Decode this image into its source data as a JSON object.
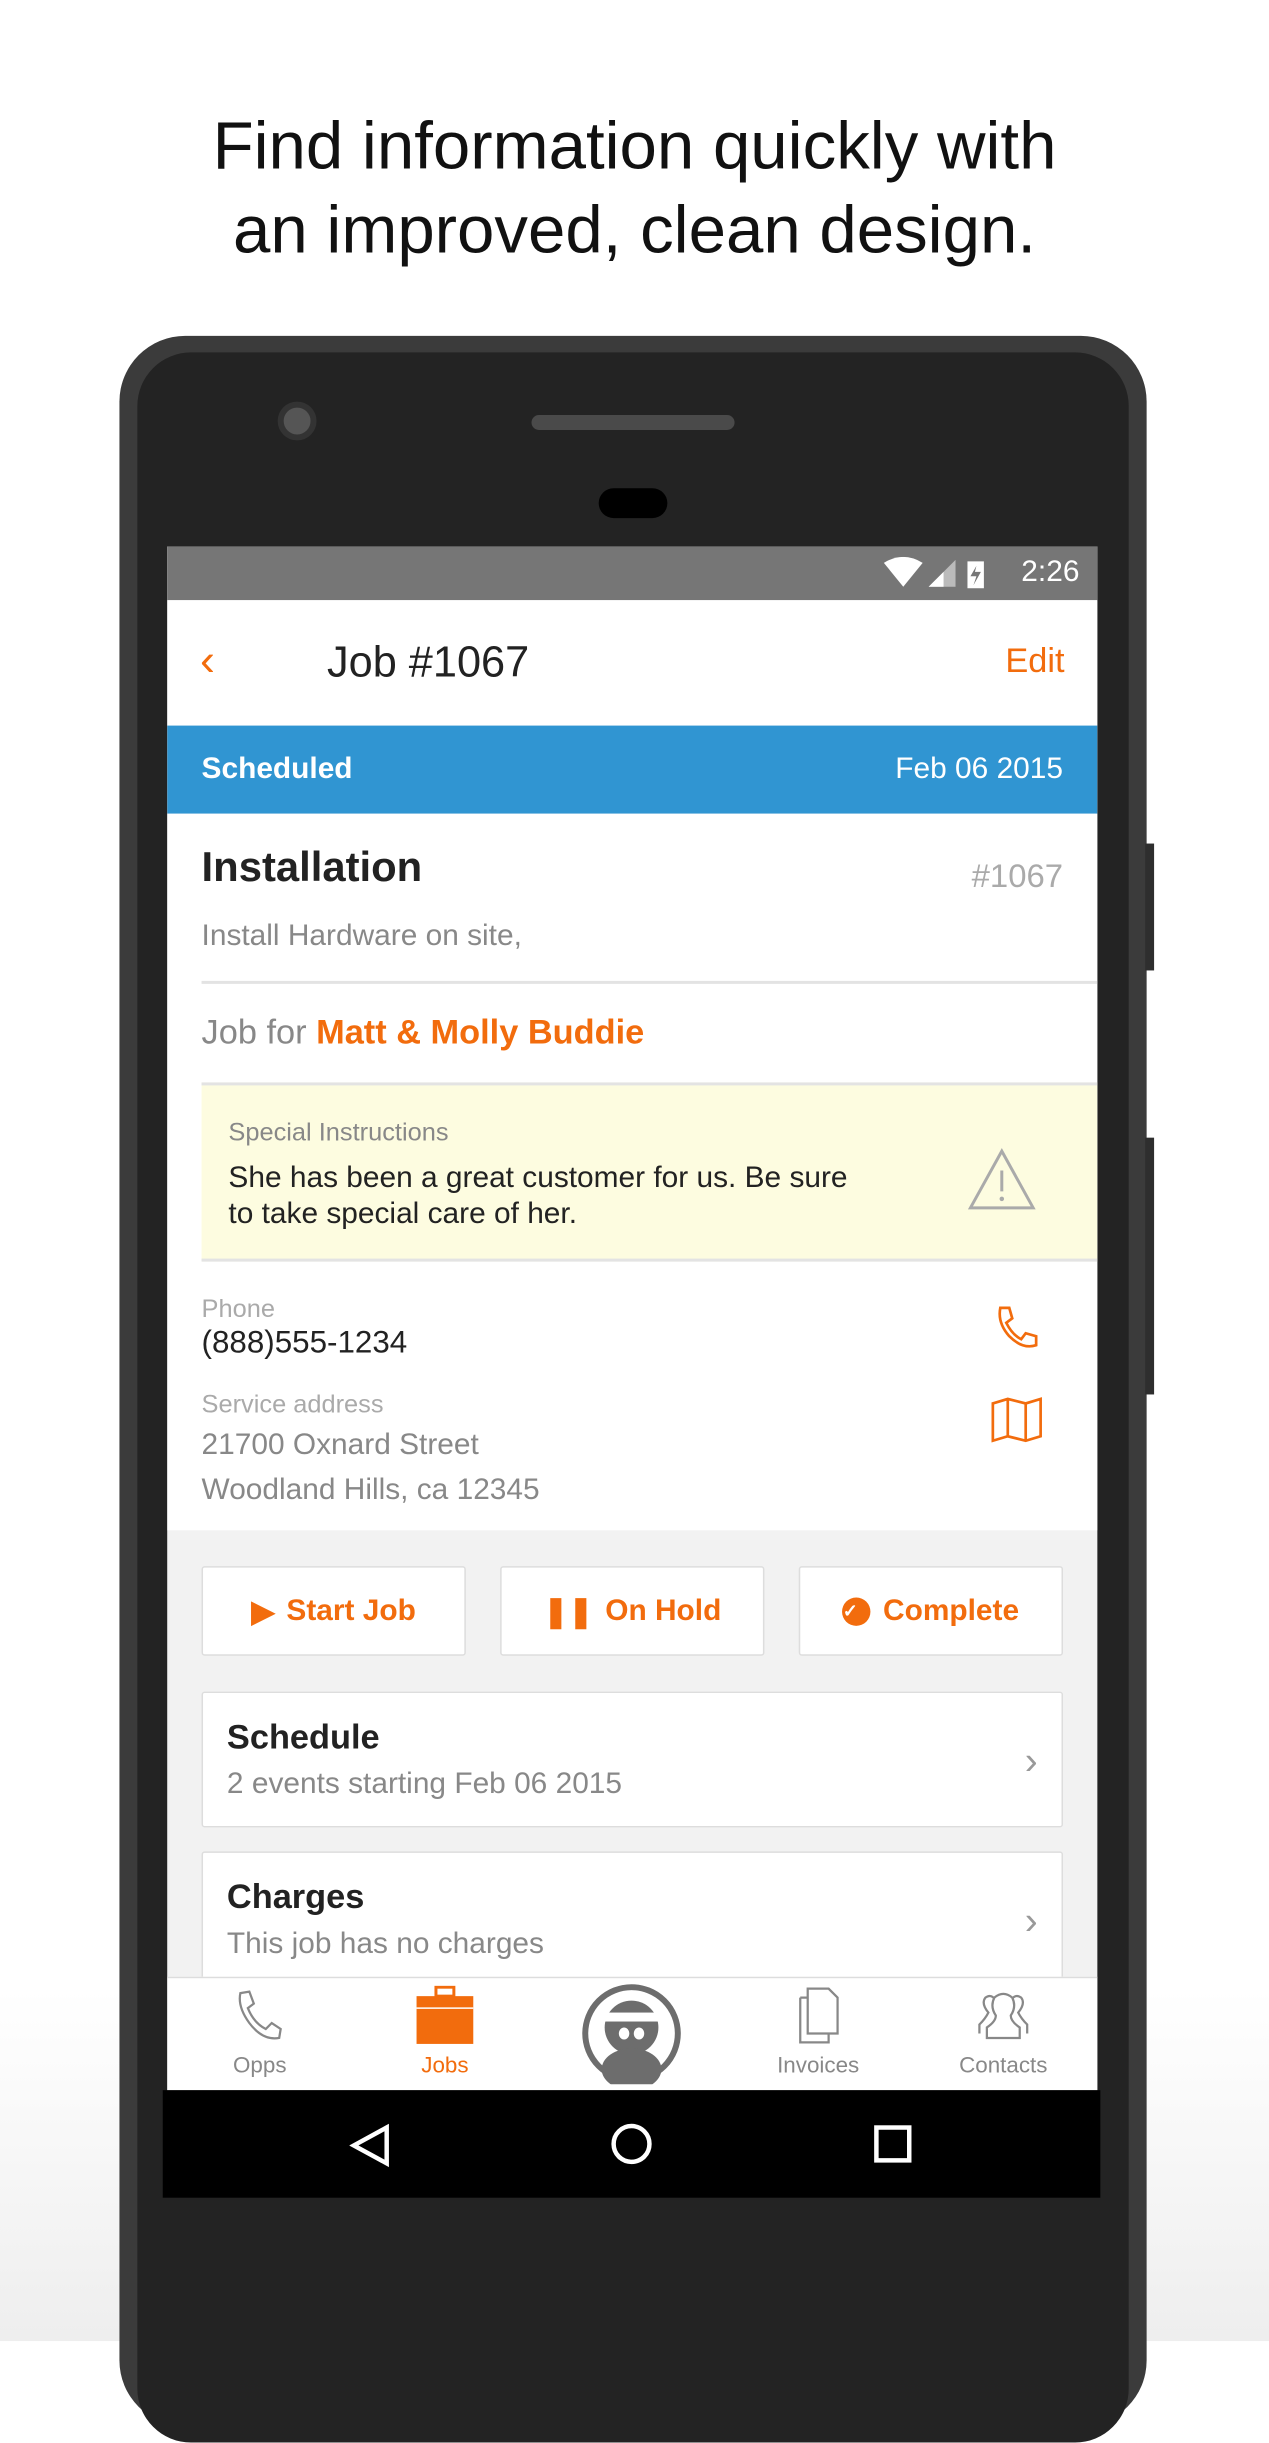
{
  "headline": [
    "Find information quickly with",
    "an improved, clean design."
  ],
  "status_bar": {
    "time": "2:26",
    "icons": [
      "wifi-icon",
      "signal-icon",
      "battery-charging-icon"
    ]
  },
  "header": {
    "title": "Job #1067",
    "edit_label": "Edit",
    "back_icon": "chevron-left-icon"
  },
  "status_banner": {
    "status": "Scheduled",
    "date": "Feb 06 2015",
    "color": "#3095d2"
  },
  "job": {
    "name": "Installation",
    "number": "#1067",
    "description": "Install Hardware on site,",
    "for_label": "Job for",
    "customer": "Matt & Molly Buddie"
  },
  "special_instructions": {
    "label": "Special Instructions",
    "text_lines": [
      "She has been a great customer for us.  Be sure",
      "to take special care of her."
    ]
  },
  "contact": {
    "phone_label": "Phone",
    "phone": "(888)555-1234",
    "address_label": "Service address",
    "address_lines": [
      "21700 Oxnard Street",
      "Woodland Hills, ca 12345"
    ]
  },
  "actions": [
    {
      "label": "Start Job",
      "icon": "play-icon"
    },
    {
      "label": "On Hold",
      "icon": "pause-icon"
    },
    {
      "label": "Complete",
      "icon": "check-circle-icon"
    }
  ],
  "rows": [
    {
      "title": "Schedule",
      "subtitle": "2 events starting Feb 06 2015"
    },
    {
      "title": "Charges",
      "subtitle": "This job has no charges"
    }
  ],
  "tabs": [
    {
      "label": "Opps",
      "icon": "phone-icon"
    },
    {
      "label": "Jobs",
      "icon": "briefcase-icon",
      "active": true
    },
    {
      "label": "",
      "icon": "ninja-avatar-icon"
    },
    {
      "label": "Invoices",
      "icon": "documents-icon"
    },
    {
      "label": "Contacts",
      "icon": "contacts-icon"
    }
  ],
  "accent": "#f26c0d"
}
